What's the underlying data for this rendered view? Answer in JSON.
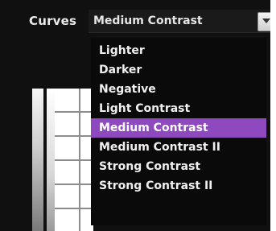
{
  "curves": {
    "label": "Curves",
    "selected_value": "Medium Contrast",
    "options": [
      "Lighter",
      "Darker",
      "Negative",
      "Light Contrast",
      "Medium Contrast",
      "Medium Contrast II",
      "Strong Contrast",
      "Strong Contrast II"
    ],
    "highlighted_index": 4
  },
  "icons": {
    "dropdown": "chevron-down-icon"
  },
  "colors": {
    "panel_bg": "#101010",
    "menu_bg": "#0a0a0a",
    "highlight": "#8e49bf",
    "text": "#f0f0f0"
  }
}
